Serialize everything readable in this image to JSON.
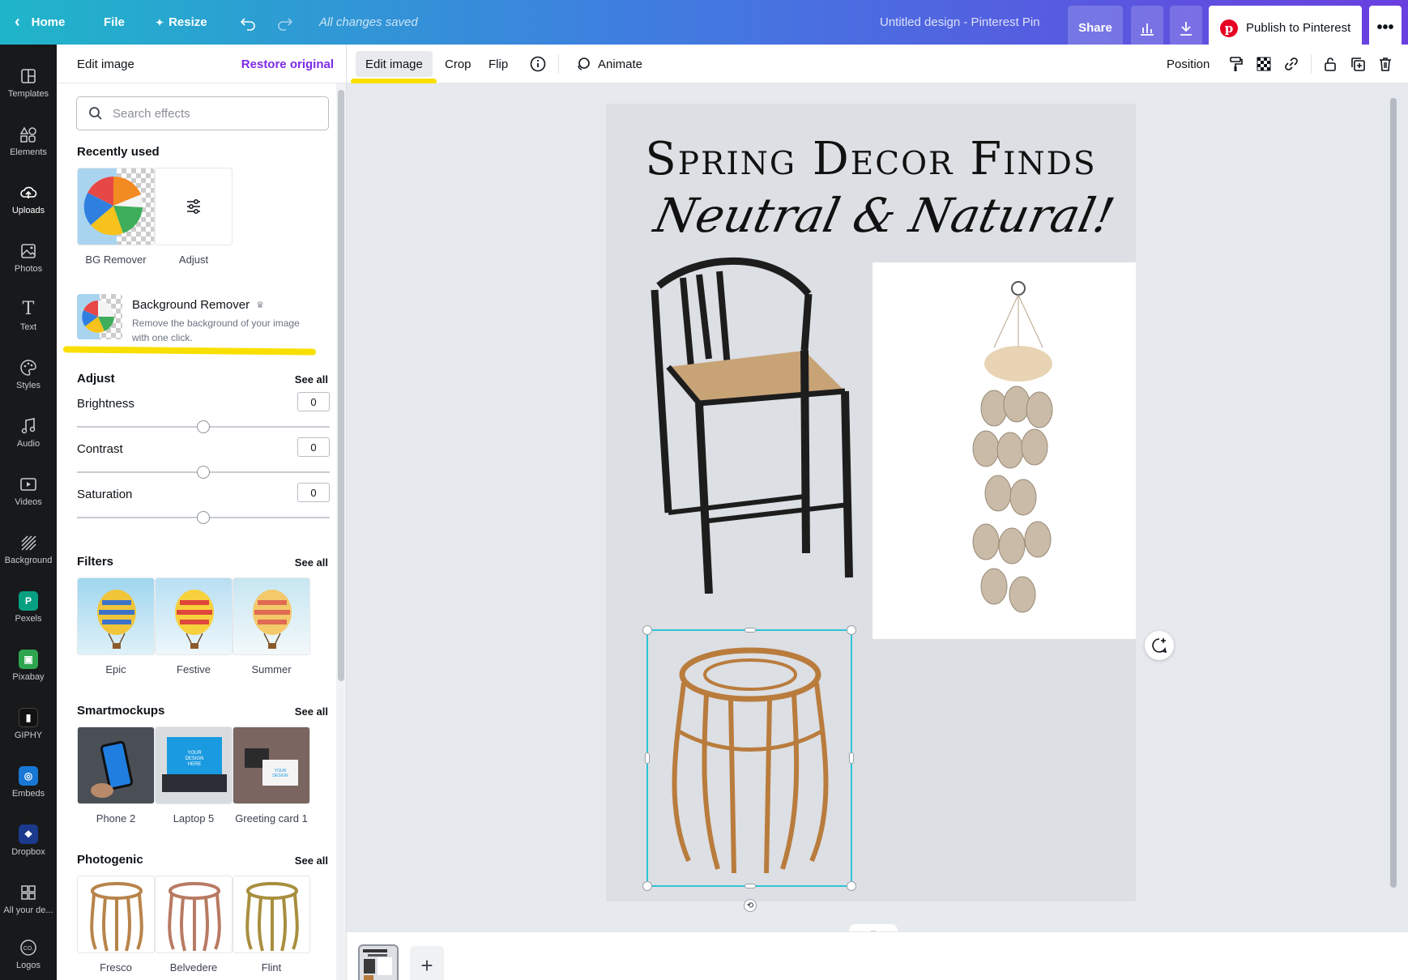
{
  "topbar": {
    "home": "Home",
    "file": "File",
    "resize": "Resize",
    "saved": "All changes saved",
    "doc_title": "Untitled design - Pinterest Pin",
    "share": "Share",
    "publish": "Publish to Pinterest"
  },
  "rail": {
    "items": [
      {
        "label": "Templates"
      },
      {
        "label": "Elements"
      },
      {
        "label": "Uploads"
      },
      {
        "label": "Photos"
      },
      {
        "label": "Text"
      },
      {
        "label": "Styles"
      },
      {
        "label": "Audio"
      },
      {
        "label": "Videos"
      },
      {
        "label": "Background"
      },
      {
        "label": "Pexels"
      },
      {
        "label": "Pixabay"
      },
      {
        "label": "GIPHY"
      },
      {
        "label": "Embeds"
      },
      {
        "label": "Dropbox"
      },
      {
        "label": "All your de..."
      },
      {
        "label": "Logos"
      }
    ]
  },
  "panel": {
    "title": "Edit image",
    "restore": "Restore original",
    "search_placeholder": "Search effects",
    "recently_used": {
      "title": "Recently used",
      "items": [
        {
          "label": "BG Remover"
        },
        {
          "label": "Adjust"
        }
      ]
    },
    "bg_remover": {
      "title": "Background Remover",
      "desc_line1": "Remove the background of your image",
      "desc_line2": "with one click."
    },
    "adjust": {
      "title": "Adjust",
      "see_all": "See all",
      "rows": [
        {
          "label": "Brightness",
          "value": "0"
        },
        {
          "label": "Contrast",
          "value": "0"
        },
        {
          "label": "Saturation",
          "value": "0"
        }
      ]
    },
    "filters": {
      "title": "Filters",
      "see_all": "See all",
      "items": [
        {
          "label": "Epic"
        },
        {
          "label": "Festive"
        },
        {
          "label": "Summer"
        }
      ]
    },
    "smartmockups": {
      "title": "Smartmockups",
      "see_all": "See all",
      "items": [
        {
          "label": "Phone 2"
        },
        {
          "label": "Laptop 5"
        },
        {
          "label": "Greeting card 1"
        }
      ]
    },
    "photogenic": {
      "title": "Photogenic",
      "see_all": "See all",
      "items": [
        {
          "label": "Fresco"
        },
        {
          "label": "Belvedere"
        },
        {
          "label": "Flint"
        }
      ]
    }
  },
  "ctxbar": {
    "edit_image": "Edit image",
    "crop": "Crop",
    "flip": "Flip",
    "animate": "Animate",
    "position": "Position"
  },
  "design": {
    "title": "Spring Decor Finds",
    "subtitle": "Neutral & Natural!"
  },
  "colors": {
    "accent": "#7d2ae8",
    "selection": "#2ec4d6",
    "highlight": "#f9df00",
    "pinterest": "#e60023"
  }
}
